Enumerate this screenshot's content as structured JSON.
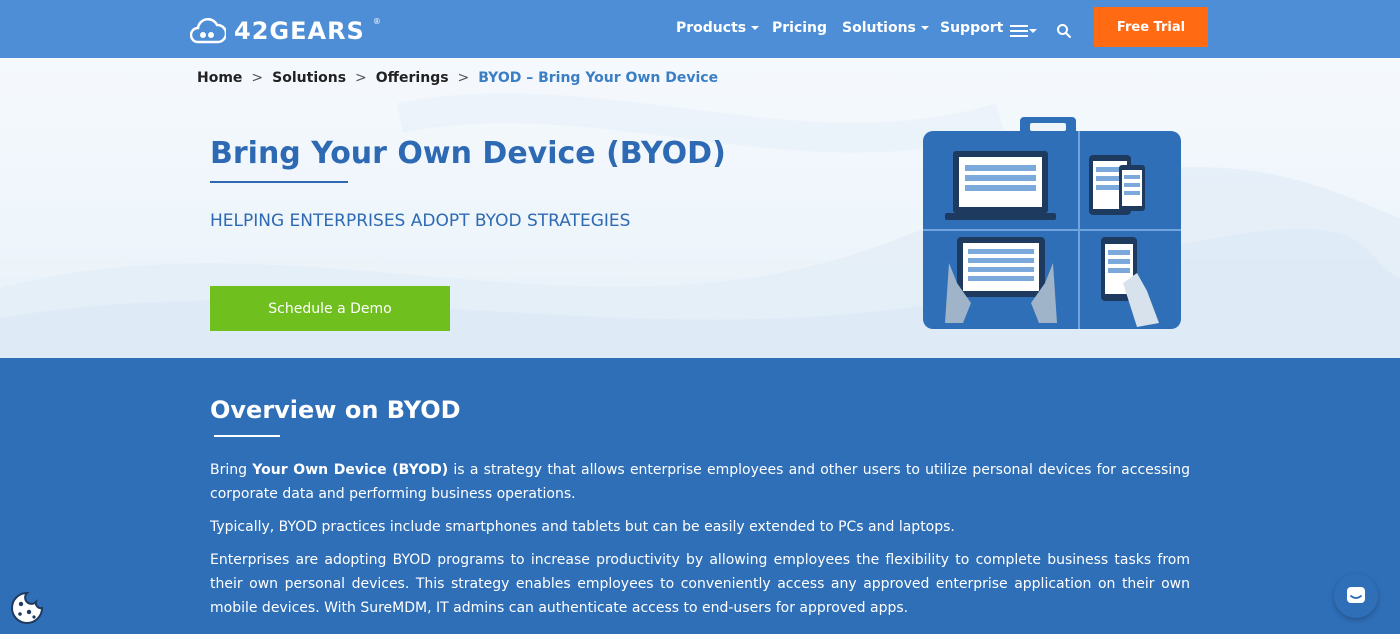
{
  "header": {
    "logo_text": "42GEARS",
    "logo_mark": "®",
    "nav": [
      {
        "label": "Products",
        "has_caret": true
      },
      {
        "label": "Pricing",
        "has_caret": false
      },
      {
        "label": "Solutions",
        "has_caret": true
      },
      {
        "label": "Support",
        "has_caret": false
      }
    ],
    "cta_label": "Free Trial",
    "colors": {
      "bar": "#4d8ed6",
      "cta": "#ff6a13"
    }
  },
  "breadcrumb": {
    "items": [
      "Home",
      "Solutions",
      "Offerings"
    ],
    "separator": ">",
    "current": "BYOD – Bring Your Own Device"
  },
  "hero": {
    "title": "Bring Your Own Device (BYOD)",
    "subtitle": "HELPING ENTERPRISES ADOPT BYOD STRATEGIES",
    "button_label": "Schedule a Demo",
    "colors": {
      "title": "#2d6ab3",
      "button": "#6fbf1f"
    }
  },
  "overview": {
    "title": "Overview on BYOD",
    "p1_pre": "Bring ",
    "p1_bold": "Your Own Device (BYOD)",
    "p1_post": " is a strategy that allows enterprise employees and other users to utilize personal devices for accessing corporate data and performing business operations.",
    "p2": "Typically, BYOD practices include smartphones and tablets but can be easily extended to PCs and laptops.",
    "p3": "Enterprises are adopting BYOD programs to increase productivity by allowing employees the flexibility to complete business tasks from their own personal devices. This strategy enables employees to conveniently access any approved enterprise application on their own mobile devices. With SureMDM, IT admins can authenticate access to end-users for approved apps.",
    "colors": {
      "background": "#2f6fb8"
    }
  },
  "icons": [
    "cloud-logo-icon",
    "menu-icon",
    "search-icon",
    "briefcase-devices-illustration",
    "cookie-icon",
    "chat-icon"
  ]
}
